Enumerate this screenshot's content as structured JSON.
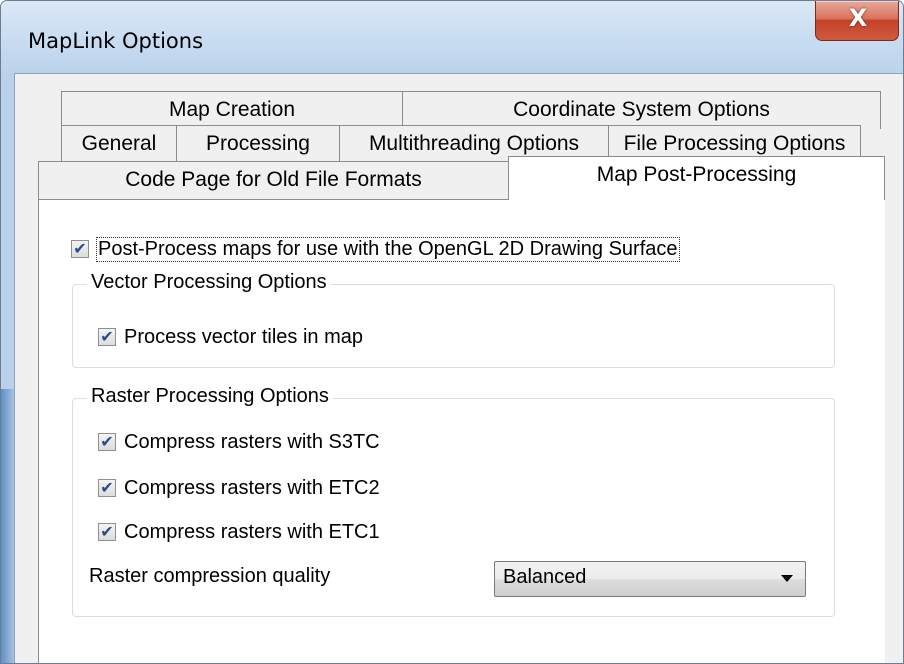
{
  "window": {
    "title": "MapLink Options",
    "close_glyph": "X",
    "close_icon": "close-icon"
  },
  "tabs": {
    "row1": [
      {
        "label": "Map Creation"
      },
      {
        "label": "Coordinate System Options"
      }
    ],
    "row2": [
      {
        "label": "General"
      },
      {
        "label": "Processing"
      },
      {
        "label": "Multithreading Options"
      },
      {
        "label": "File Processing Options"
      }
    ],
    "row3": [
      {
        "label": "Code Page for Old File Formats"
      },
      {
        "label": "Map Post-Processing",
        "selected": true
      }
    ]
  },
  "panel": {
    "main_checkbox": {
      "label": "Post-Process maps for use with the OpenGL 2D Drawing Surface",
      "checked": true
    },
    "vector_group": {
      "title": "Vector Processing Options",
      "items": [
        {
          "label": "Process vector tiles in map",
          "checked": true
        }
      ]
    },
    "raster_group": {
      "title": "Raster Processing Options",
      "items": [
        {
          "label": "Compress rasters with S3TC",
          "checked": true
        },
        {
          "label": "Compress rasters with ETC2",
          "checked": true
        },
        {
          "label": "Compress rasters with ETC1",
          "checked": true
        }
      ],
      "quality_label": "Raster compression quality",
      "quality_value": "Balanced"
    }
  },
  "check_glyph": "✔",
  "colors": {
    "checkmark": "#2a4c8f",
    "close_button": "#c3432a",
    "title_bar": "#c8dcf1"
  }
}
